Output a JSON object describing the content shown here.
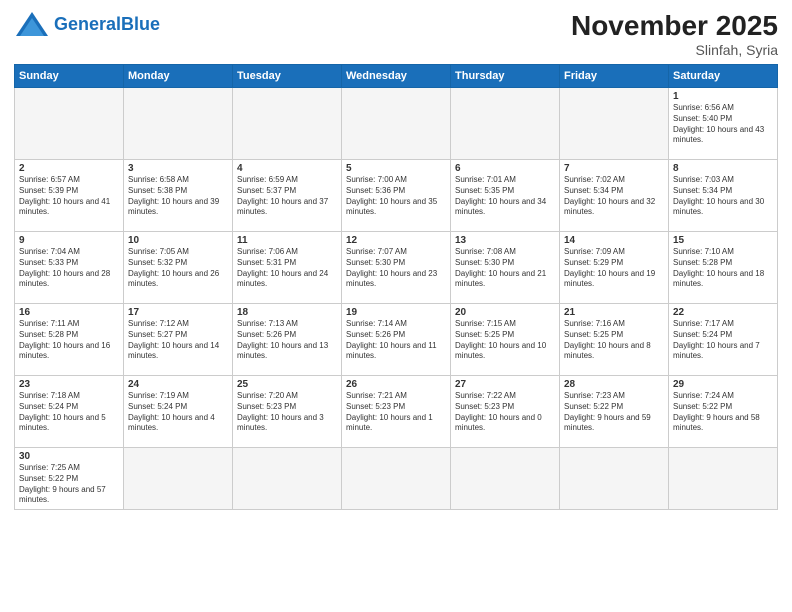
{
  "logo": {
    "text_general": "General",
    "text_blue": "Blue"
  },
  "header": {
    "month": "November 2025",
    "location": "Slinfah, Syria"
  },
  "weekdays": [
    "Sunday",
    "Monday",
    "Tuesday",
    "Wednesday",
    "Thursday",
    "Friday",
    "Saturday"
  ],
  "weeks": [
    [
      {
        "day": "",
        "empty": true
      },
      {
        "day": "",
        "empty": true
      },
      {
        "day": "",
        "empty": true
      },
      {
        "day": "",
        "empty": true
      },
      {
        "day": "",
        "empty": true
      },
      {
        "day": "",
        "empty": true
      },
      {
        "day": "1",
        "sunrise": "6:56 AM",
        "sunset": "5:40 PM",
        "daylight": "10 hours and 43 minutes."
      }
    ],
    [
      {
        "day": "2",
        "sunrise": "6:57 AM",
        "sunset": "5:39 PM",
        "daylight": "10 hours and 41 minutes."
      },
      {
        "day": "3",
        "sunrise": "6:58 AM",
        "sunset": "5:38 PM",
        "daylight": "10 hours and 39 minutes."
      },
      {
        "day": "4",
        "sunrise": "6:59 AM",
        "sunset": "5:37 PM",
        "daylight": "10 hours and 37 minutes."
      },
      {
        "day": "5",
        "sunrise": "7:00 AM",
        "sunset": "5:36 PM",
        "daylight": "10 hours and 35 minutes."
      },
      {
        "day": "6",
        "sunrise": "7:01 AM",
        "sunset": "5:35 PM",
        "daylight": "10 hours and 34 minutes."
      },
      {
        "day": "7",
        "sunrise": "7:02 AM",
        "sunset": "5:34 PM",
        "daylight": "10 hours and 32 minutes."
      },
      {
        "day": "8",
        "sunrise": "7:03 AM",
        "sunset": "5:34 PM",
        "daylight": "10 hours and 30 minutes."
      }
    ],
    [
      {
        "day": "9",
        "sunrise": "7:04 AM",
        "sunset": "5:33 PM",
        "daylight": "10 hours and 28 minutes."
      },
      {
        "day": "10",
        "sunrise": "7:05 AM",
        "sunset": "5:32 PM",
        "daylight": "10 hours and 26 minutes."
      },
      {
        "day": "11",
        "sunrise": "7:06 AM",
        "sunset": "5:31 PM",
        "daylight": "10 hours and 24 minutes."
      },
      {
        "day": "12",
        "sunrise": "7:07 AM",
        "sunset": "5:30 PM",
        "daylight": "10 hours and 23 minutes."
      },
      {
        "day": "13",
        "sunrise": "7:08 AM",
        "sunset": "5:30 PM",
        "daylight": "10 hours and 21 minutes."
      },
      {
        "day": "14",
        "sunrise": "7:09 AM",
        "sunset": "5:29 PM",
        "daylight": "10 hours and 19 minutes."
      },
      {
        "day": "15",
        "sunrise": "7:10 AM",
        "sunset": "5:28 PM",
        "daylight": "10 hours and 18 minutes."
      }
    ],
    [
      {
        "day": "16",
        "sunrise": "7:11 AM",
        "sunset": "5:28 PM",
        "daylight": "10 hours and 16 minutes."
      },
      {
        "day": "17",
        "sunrise": "7:12 AM",
        "sunset": "5:27 PM",
        "daylight": "10 hours and 14 minutes."
      },
      {
        "day": "18",
        "sunrise": "7:13 AM",
        "sunset": "5:26 PM",
        "daylight": "10 hours and 13 minutes."
      },
      {
        "day": "19",
        "sunrise": "7:14 AM",
        "sunset": "5:26 PM",
        "daylight": "10 hours and 11 minutes."
      },
      {
        "day": "20",
        "sunrise": "7:15 AM",
        "sunset": "5:25 PM",
        "daylight": "10 hours and 10 minutes."
      },
      {
        "day": "21",
        "sunrise": "7:16 AM",
        "sunset": "5:25 PM",
        "daylight": "10 hours and 8 minutes."
      },
      {
        "day": "22",
        "sunrise": "7:17 AM",
        "sunset": "5:24 PM",
        "daylight": "10 hours and 7 minutes."
      }
    ],
    [
      {
        "day": "23",
        "sunrise": "7:18 AM",
        "sunset": "5:24 PM",
        "daylight": "10 hours and 5 minutes."
      },
      {
        "day": "24",
        "sunrise": "7:19 AM",
        "sunset": "5:24 PM",
        "daylight": "10 hours and 4 minutes."
      },
      {
        "day": "25",
        "sunrise": "7:20 AM",
        "sunset": "5:23 PM",
        "daylight": "10 hours and 3 minutes."
      },
      {
        "day": "26",
        "sunrise": "7:21 AM",
        "sunset": "5:23 PM",
        "daylight": "10 hours and 1 minute."
      },
      {
        "day": "27",
        "sunrise": "7:22 AM",
        "sunset": "5:23 PM",
        "daylight": "10 hours and 0 minutes."
      },
      {
        "day": "28",
        "sunrise": "7:23 AM",
        "sunset": "5:22 PM",
        "daylight": "9 hours and 59 minutes."
      },
      {
        "day": "29",
        "sunrise": "7:24 AM",
        "sunset": "5:22 PM",
        "daylight": "9 hours and 58 minutes."
      }
    ],
    [
      {
        "day": "30",
        "sunrise": "7:25 AM",
        "sunset": "5:22 PM",
        "daylight": "9 hours and 57 minutes."
      },
      {
        "day": "",
        "empty": true
      },
      {
        "day": "",
        "empty": true
      },
      {
        "day": "",
        "empty": true
      },
      {
        "day": "",
        "empty": true
      },
      {
        "day": "",
        "empty": true
      },
      {
        "day": "",
        "empty": true
      }
    ]
  ]
}
